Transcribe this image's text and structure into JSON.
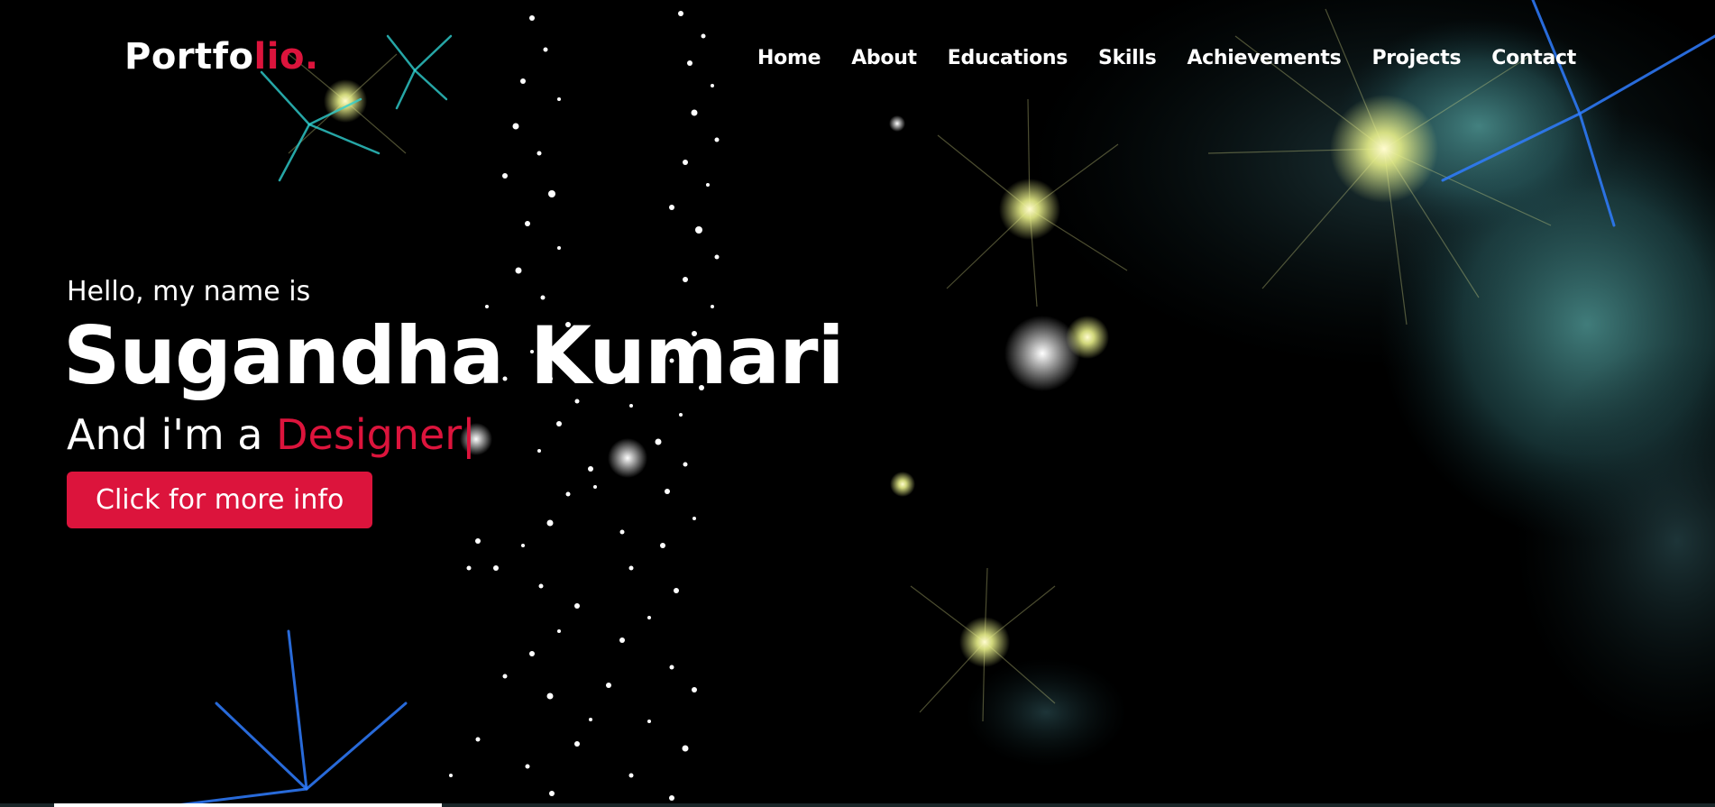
{
  "navbar": {
    "logo": {
      "text_main": "Portfo",
      "text_accent": "lio."
    },
    "menu": [
      {
        "label": "Home"
      },
      {
        "label": "About"
      },
      {
        "label": "Educations"
      },
      {
        "label": "Skills"
      },
      {
        "label": "Achievements"
      },
      {
        "label": "Projects"
      },
      {
        "label": "Contact"
      }
    ]
  },
  "hero": {
    "greeting": "Hello, my name is",
    "name": "Sugandha Kumari",
    "role_prefix": "And i'm a ",
    "role_typed": "Designer",
    "cursor": "|",
    "cta_label": "Click for more info"
  },
  "colors": {
    "accent": "#dc143c",
    "background": "#000000",
    "text": "#ffffff"
  }
}
